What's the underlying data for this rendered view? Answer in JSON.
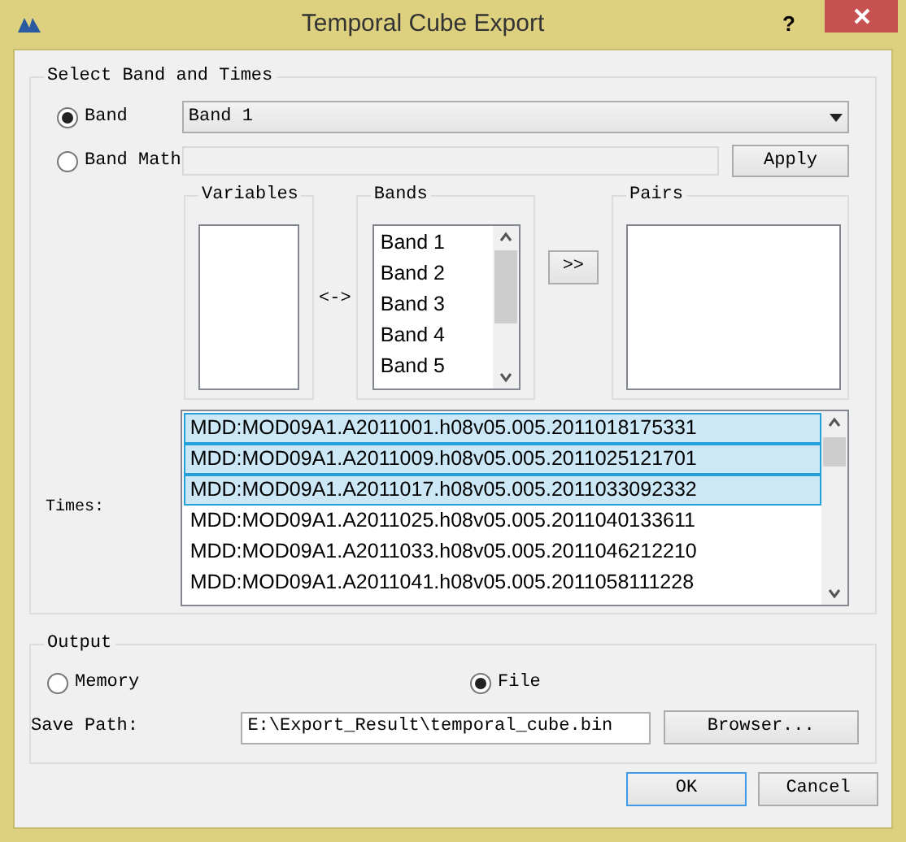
{
  "window": {
    "title": "Temporal Cube Export",
    "help": "?"
  },
  "select_group": {
    "title": "Select Band and Times",
    "modes": [
      {
        "label": "Band",
        "selected": true
      },
      {
        "label": "Band Math",
        "selected": false
      }
    ],
    "band_combo": {
      "value": "Band 1"
    },
    "apply_button": "Apply",
    "variables": {
      "title": "Variables"
    },
    "swap_label": "<->",
    "bands": {
      "title": "Bands",
      "items": [
        "Band 1",
        "Band 2",
        "Band 3",
        "Band 4",
        "Band 5"
      ]
    },
    "add_button": ">>",
    "pairs": {
      "title": "Pairs"
    },
    "times": {
      "label": "Times:",
      "items": [
        {
          "text": "MDD:MOD09A1.A2011001.h08v05.005.2011018175331",
          "selected": true
        },
        {
          "text": "MDD:MOD09A1.A2011009.h08v05.005.2011025121701",
          "selected": true
        },
        {
          "text": "MDD:MOD09A1.A2011017.h08v05.005.2011033092332",
          "selected": true
        },
        {
          "text": "MDD:MOD09A1.A2011025.h08v05.005.2011040133611",
          "selected": false
        },
        {
          "text": "MDD:MOD09A1.A2011033.h08v05.005.2011046212210",
          "selected": false
        },
        {
          "text": "MDD:MOD09A1.A2011041.h08v05.005.2011058111228",
          "selected": false
        }
      ]
    }
  },
  "output_group": {
    "title": "Output",
    "targets": [
      {
        "label": "Memory",
        "selected": false
      },
      {
        "label": "File",
        "selected": true
      }
    ],
    "save_path": {
      "label": "Save Path:",
      "value": "E:\\Export_Result\\temporal_cube.bin"
    },
    "browse_button": "Browser..."
  },
  "buttons": [
    {
      "label": "OK",
      "default": true
    },
    {
      "label": "Cancel",
      "default": false
    }
  ]
}
